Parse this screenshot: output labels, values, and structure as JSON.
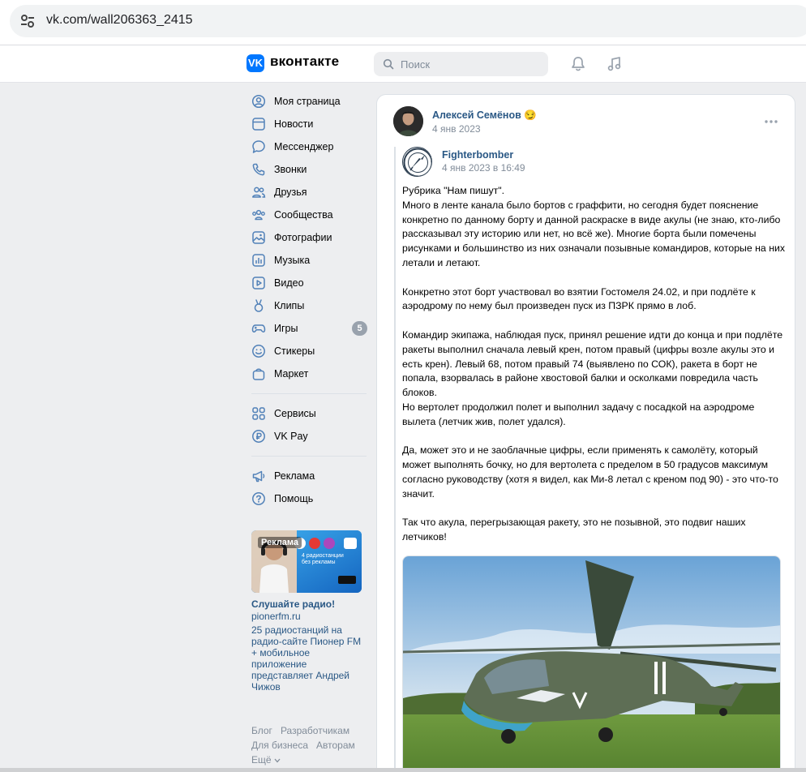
{
  "browser": {
    "url": "vk.com/wall206363_2415"
  },
  "header": {
    "logo_text": "вконтакте",
    "logo_mark": "VK",
    "search_placeholder": "Поиск",
    "icons": [
      "bell-icon",
      "music-note-icon"
    ]
  },
  "sidebar": {
    "items": [
      {
        "label": "Моя страница",
        "icon": "user-circle-icon"
      },
      {
        "label": "Новости",
        "icon": "news-icon"
      },
      {
        "label": "Мессенджер",
        "icon": "message-bubble-icon"
      },
      {
        "label": "Звонки",
        "icon": "phone-icon"
      },
      {
        "label": "Друзья",
        "icon": "friends-icon"
      },
      {
        "label": "Сообщества",
        "icon": "communities-icon"
      },
      {
        "label": "Фотографии",
        "icon": "photo-icon"
      },
      {
        "label": "Музыка",
        "icon": "music-bars-icon"
      },
      {
        "label": "Видео",
        "icon": "video-icon"
      },
      {
        "label": "Клипы",
        "icon": "clips-icon"
      },
      {
        "label": "Игры",
        "icon": "gamepad-icon",
        "badge": "5"
      },
      {
        "label": "Стикеры",
        "icon": "smile-icon"
      },
      {
        "label": "Маркет",
        "icon": "bag-icon"
      }
    ],
    "items2": [
      {
        "label": "Сервисы",
        "icon": "services-icon"
      },
      {
        "label": "VK Pay",
        "icon": "vkpay-icon"
      }
    ],
    "items3": [
      {
        "label": "Реклама",
        "icon": "megaphone-icon"
      },
      {
        "label": "Помощь",
        "icon": "help-icon"
      }
    ],
    "ad": {
      "badge": "Реклама",
      "image_caption": "4 радиостанции без рекламы",
      "title": "Слушайте радио!",
      "domain": "pionerfm.ru",
      "description": "25 радиостанций на радио-сайте Пионер FM + мобильное приложение представляет Андрей Чижов"
    },
    "footer": {
      "blog": "Блог",
      "developers": "Разработчикам",
      "business": "Для бизнеса",
      "authors": "Авторам",
      "more": "Ещё"
    }
  },
  "post": {
    "author": "Алексей Семёнов",
    "author_emoji": "😏",
    "date": "4 янв 2023",
    "repost": {
      "author": "Fighterbomber",
      "date": "4 янв 2023 в 16:49"
    },
    "paragraphs": [
      "Рубрика \"Нам пишут\".\nМного в ленте канала было бортов с граффити, но сегодня будет пояснение конкретно по данному борту и данной раскраске в виде акулы (не знаю, кто-либо рассказывал эту историю или нет, но всё же). Многие борта были помечены рисунками и большинство из них означали позывные командиров, которые на них летали и летают.",
      "Конкретно этот борт участвовал во взятии Гостомеля 24.02, и при подлёте к аэродрому по нему был произведен пуск из ПЗРК прямо в лоб.",
      "Командир экипажа, наблюдая пуск, принял решение идти до конца и при подлёте ракеты выполнил сначала левый крен, потом правый (цифры возле акулы это и есть крен). Левый 68, потом правый 74 (выявлено по СОК), ракета в борт не попала, взорвалась в районе хвостовой балки и осколками повредила часть блоков.\nНо вертолет продолжил полет и выполнил задачу с посадкой на аэродроме вылета (летчик жив, полет удался).",
      "Да, может это и не заоблачные цифры, если применять к самолёту, который может выполнять бочку, но для вертолета с пределом в 50 градусов максимум согласно руководству (хотя я видел, как Ми-8 летал с креном под 90) - это что-то значит.",
      "Так что акула, перегрызающая ракету, это не позывной, это подвиг наших летчиков!"
    ]
  },
  "colors": {
    "accent": "#0077ff",
    "link": "#2a5885",
    "muted": "#818c99",
    "page_bg": "#edeef0"
  }
}
